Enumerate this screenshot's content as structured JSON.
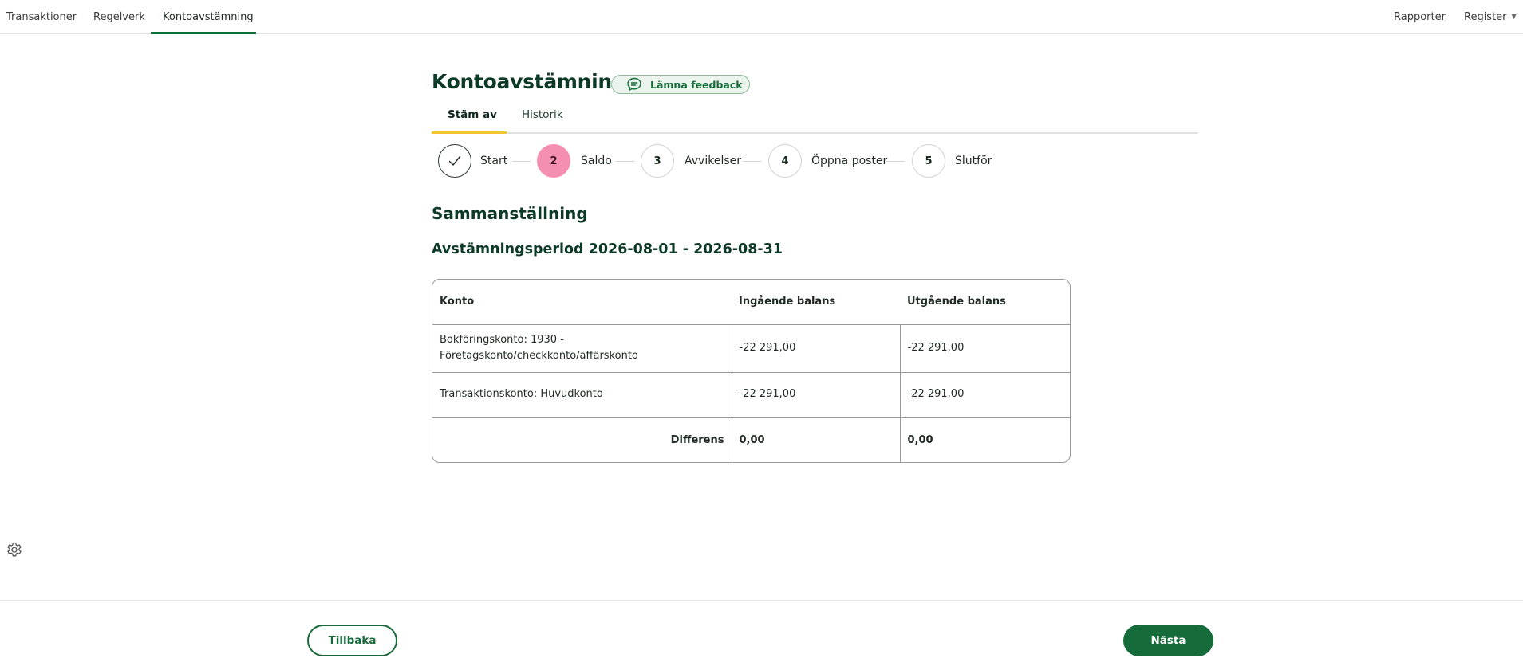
{
  "nav": {
    "left": [
      "Transaktioner",
      "Regelverk",
      "Kontoavstämning"
    ],
    "right": {
      "reports": "Rapporter",
      "register": "Register"
    }
  },
  "header": {
    "title": "Kontoavstämning",
    "feedback_label": "Lämna feedback"
  },
  "tabs": [
    "Stäm av",
    "Historik"
  ],
  "steps": [
    {
      "number": "",
      "label": "Start",
      "state": "done"
    },
    {
      "number": "2",
      "label": "Saldo",
      "state": "current"
    },
    {
      "number": "3",
      "label": "Avvikelser",
      "state": "pending"
    },
    {
      "number": "4",
      "label": "Öppna poster",
      "state": "pending"
    },
    {
      "number": "5",
      "label": "Slutför",
      "state": "pending"
    }
  ],
  "summary": {
    "title": "Sammanställning",
    "period": "Avstämningsperiod 2026-08-01 - 2026-08-31"
  },
  "table": {
    "headers": [
      "Konto",
      "Ingående balans",
      "Utgående balans"
    ],
    "rows": [
      {
        "account_line1": "Bokföringskonto: 1930 -",
        "account_line2": "Företagskonto/checkkonto/affärskonto",
        "opening": "-22 291,00",
        "closing": "-22 291,00"
      },
      {
        "account": "Transaktionskonto: Huvudkonto",
        "opening": "-22 291,00",
        "closing": "-22 291,00"
      }
    ],
    "diff": {
      "label": "Differens",
      "opening": "0,00",
      "closing": "0,00"
    }
  },
  "footer": {
    "back_label": "Tillbaka",
    "next_label": "Nästa"
  },
  "colors": {
    "brand_green": "#156b3a",
    "current_step_pink": "#f58fb1",
    "tab_accent": "#f2c531"
  },
  "icons": [
    "chat-bubble-icon",
    "checkmark-icon",
    "gear-icon",
    "caret-down-icon"
  ]
}
